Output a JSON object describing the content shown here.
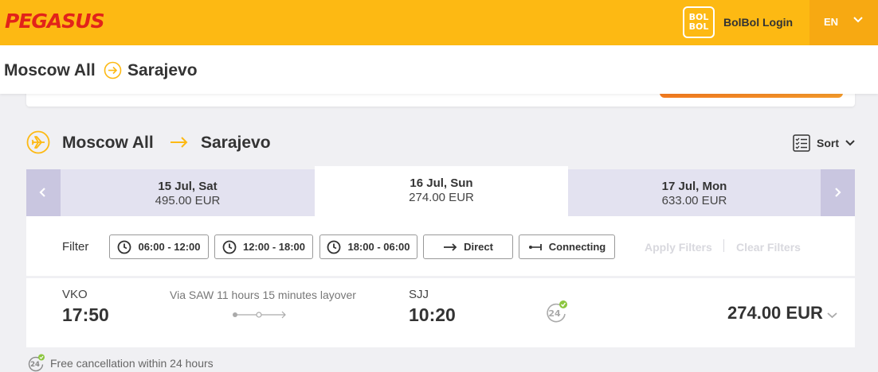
{
  "header": {
    "logo_text": "PEGASUS",
    "bolbol_badge": [
      "BOL",
      "BOL"
    ],
    "bolbol_login": "BolBol Login",
    "language": "EN",
    "colors": {
      "brand_yellow": "#fdb913",
      "logo_red": "#e2231a",
      "lang_bg": "#f7a912"
    }
  },
  "route_bar": {
    "from": "Moscow All",
    "to": "Sarajevo"
  },
  "section": {
    "from": "Moscow All",
    "to": "Sarajevo",
    "sort_label": "Sort"
  },
  "dates": [
    {
      "date": "15 Jul, Sat",
      "price": "495.00 EUR",
      "active": false
    },
    {
      "date": "16 Jul, Sun",
      "price": "274.00 EUR",
      "active": true
    },
    {
      "date": "17 Jul, Mon",
      "price": "633.00 EUR",
      "active": false
    }
  ],
  "filters": {
    "label": "Filter",
    "options": [
      "06:00 - 12:00",
      "12:00 - 18:00",
      "18:00 - 06:00",
      "Direct",
      "Connecting"
    ],
    "apply": "Apply Filters",
    "clear": "Clear Filters"
  },
  "flight": {
    "dep_code": "VKO",
    "dep_time": "17:50",
    "layover": "Via SAW 11 hours 15 minutes layover",
    "arr_code": "SJJ",
    "arr_time": "10:20",
    "badge": "24",
    "price": "274.00 EUR"
  },
  "footer_note": {
    "badge": "24",
    "text": "Free cancellation within 24 hours"
  }
}
